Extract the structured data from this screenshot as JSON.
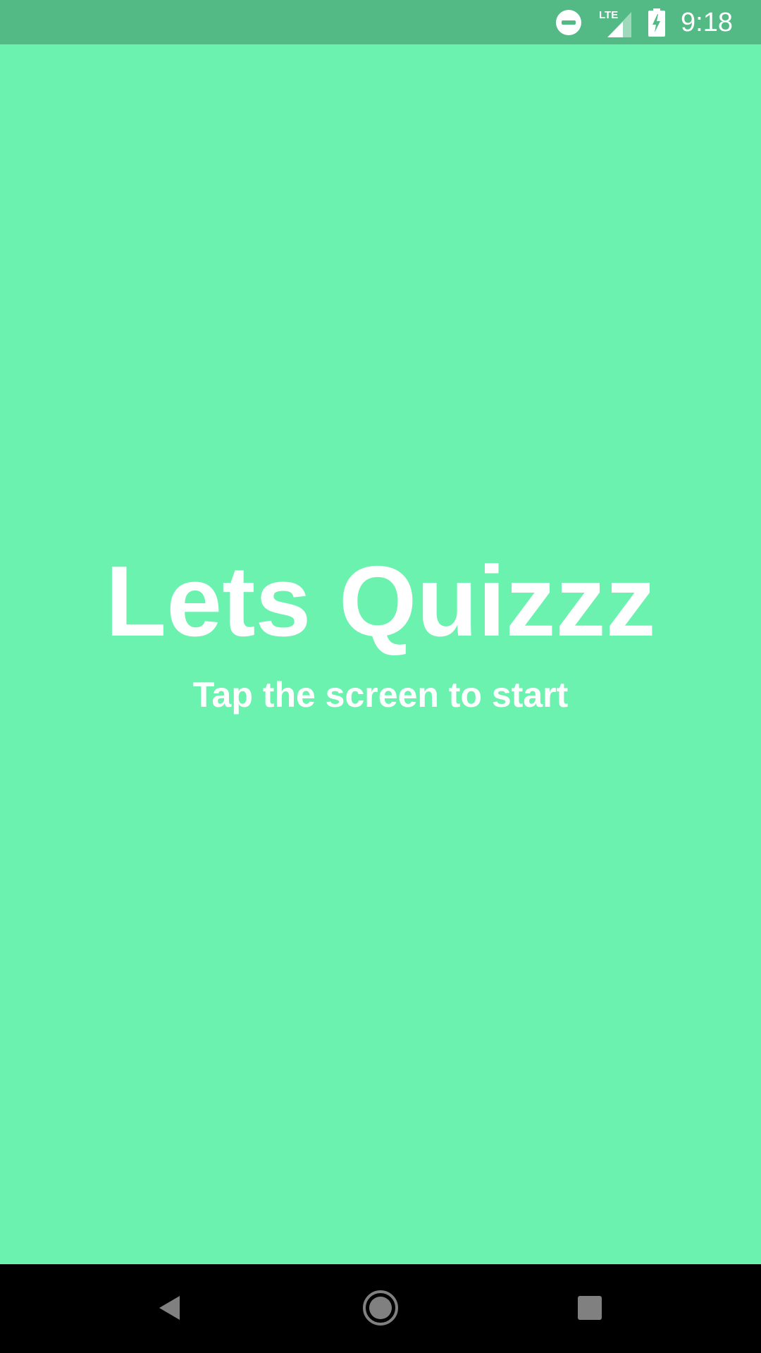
{
  "status_bar": {
    "time": "9:18",
    "network_label": "LTE",
    "icons": [
      "do-not-disturb-icon",
      "lte-signal-icon",
      "battery-charging-icon"
    ]
  },
  "main": {
    "title": "Lets Quizzz",
    "subtitle": "Tap the screen to start"
  },
  "nav_bar": {
    "buttons": [
      "back-icon",
      "home-icon",
      "recents-icon"
    ]
  },
  "colors": {
    "background": "#6cf2af",
    "status_bar": "#53b985",
    "text": "#ffffff",
    "nav_bar": "#000000"
  }
}
